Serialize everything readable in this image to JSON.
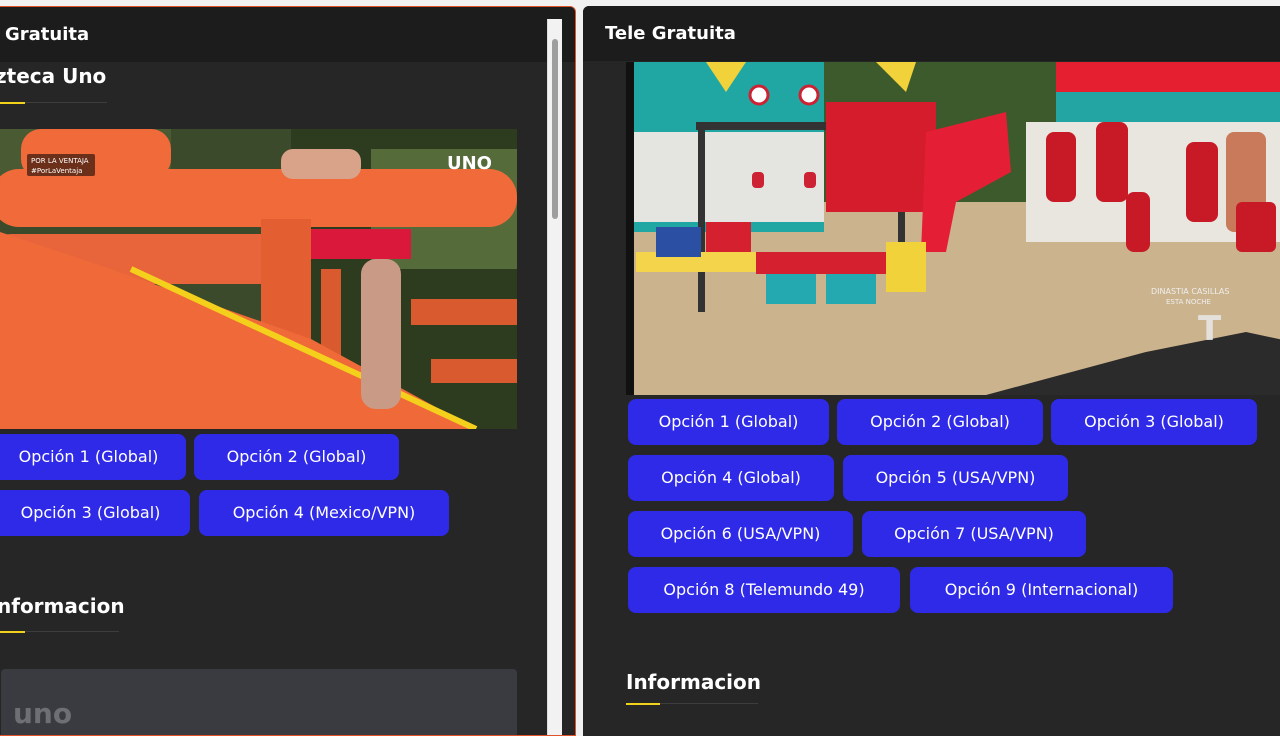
{
  "left_panel": {
    "title": "Gratuita",
    "channel_title": "zteca Uno",
    "info_title": "nformacion",
    "overlay_line1": "POR LA VENTAJA",
    "overlay_line2": "#PorLaVentaja",
    "logo_text": "UNO",
    "buttons": [
      "Opción 1 (Global)",
      "Opción 2 (Global)",
      "Opción 3 (Global)",
      "Opción 4 (Mexico/VPN)"
    ],
    "card_logo": "uno"
  },
  "right_panel": {
    "title": "Tele Gratuita",
    "info_title": "Informacion",
    "overlay_line1": "DINASTIA CASILLAS",
    "overlay_line2": "ESTA NOCHE",
    "buttons": [
      "Opción 1 (Global)",
      "Opción 2 (Global)",
      "Opción 3 (Global)",
      "Opción 4 (Global)",
      "Opción 5 (USA/VPN)",
      "Opción 6 (USA/VPN)",
      "Opción 7 (USA/VPN)",
      "Opción 8 (Telemundo 49)",
      "Opción 9 (Internacional)"
    ]
  },
  "colors": {
    "panel_bg": "#262626",
    "titlebar_bg": "#1c1c1c",
    "button_bg": "#2f2ae8",
    "accent_underline": "#f2d11b",
    "left_border": "#e0522a"
  }
}
